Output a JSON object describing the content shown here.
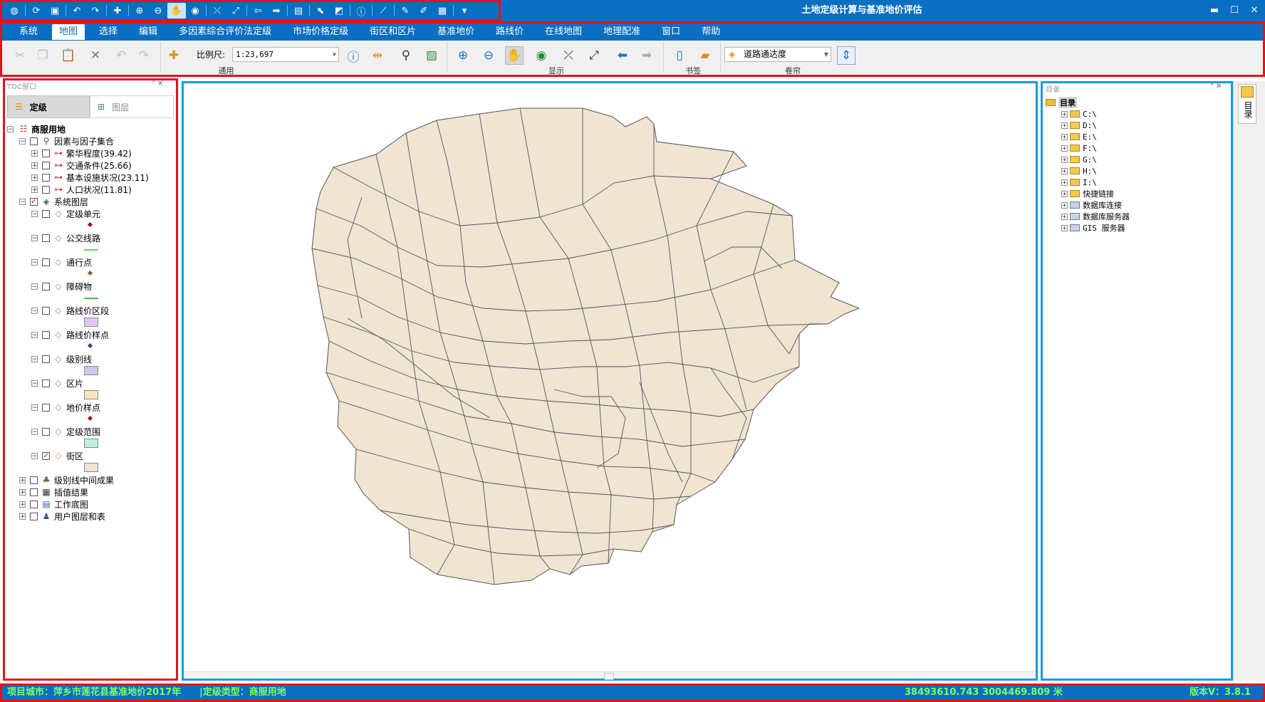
{
  "window": {
    "title": "土地定级计算与基准地价评估",
    "controls": [
      "▬",
      "☐",
      "✕"
    ]
  },
  "quick_access": {
    "icons": [
      "globe-icon",
      "refresh-icon",
      "save-icon",
      "undo-icon",
      "redo-icon",
      "add-data-icon",
      "zoom-in-icon",
      "zoom-out-icon",
      "pan-icon",
      "full-extent-icon",
      "fixed-zoom-in-icon",
      "fixed-zoom-out-icon",
      "back-icon",
      "forward-icon",
      "select-features-icon",
      "select-element-icon",
      "clear-selection-icon",
      "identify-icon",
      "measure-icon",
      "pencil-icon",
      "edit-icon",
      "clipboard-icon",
      "customize-icon"
    ]
  },
  "menu": {
    "items": [
      "系统",
      "地图",
      "选择",
      "编辑",
      "多因素综合评价法定级",
      "市场价格定级",
      "街区和区片",
      "基准地价",
      "路线价",
      "在线地图",
      "地理配准",
      "窗口",
      "帮助"
    ],
    "active_index": 1
  },
  "toolbar": {
    "scale_label": "比例尺:",
    "scale_value": "1:23,697",
    "layer_select_value": "道路通达度",
    "groups": {
      "general": "通用",
      "display": "显示",
      "bookmark": "书签",
      "band": "卷帘"
    }
  },
  "toc": {
    "header": "TOC窗口",
    "header_buttons": "ᴾ ✕",
    "tabs": [
      "定级",
      "图层"
    ],
    "tree": [
      {
        "level": 0,
        "expand": "−",
        "check": null,
        "icon": "land-use-icon",
        "label": "商服用地",
        "bold": true
      },
      {
        "level": 1,
        "expand": "−",
        "check": false,
        "icon": "factor-set-icon",
        "label": "因素与因子集合"
      },
      {
        "level": 2,
        "expand": "+",
        "check": false,
        "icon": "factor-icon",
        "label": "繁华程度(39.42)"
      },
      {
        "level": 2,
        "expand": "+",
        "check": false,
        "icon": "factor-icon",
        "label": "交通条件(25.66)"
      },
      {
        "level": 2,
        "expand": "+",
        "check": false,
        "icon": "factor-icon",
        "label": "基本设施状况(23.11)"
      },
      {
        "level": 2,
        "expand": "+",
        "check": false,
        "icon": "factor-icon",
        "label": "人口状况(11.81)"
      },
      {
        "level": 1,
        "expand": "−",
        "check": true,
        "icon": "layers-icon",
        "label": "系统图层"
      },
      {
        "level": 2,
        "expand": "−",
        "check": false,
        "icon": "layer-diamond-icon",
        "label": "定级单元",
        "symbol": "point",
        "symcolor": "#a31010"
      },
      {
        "level": 2,
        "expand": "−",
        "check": false,
        "icon": "layer-diamond-icon",
        "label": "公交线路",
        "symbol": "line",
        "symcolor": "#5fd66e"
      },
      {
        "level": 2,
        "expand": "−",
        "check": false,
        "icon": "layer-diamond-icon",
        "label": "通行点",
        "symbol": "point",
        "symcolor": "#8a5a2c"
      },
      {
        "level": 2,
        "expand": "−",
        "check": false,
        "icon": "layer-diamond-icon",
        "label": "障碍物",
        "symbol": "line",
        "symcolor": "#3cbf4a"
      },
      {
        "level": 2,
        "expand": "−",
        "check": false,
        "icon": "layer-diamond-icon",
        "label": "路线价区段",
        "symbol": "rect",
        "symcolor": "#e6c3f2"
      },
      {
        "level": 2,
        "expand": "−",
        "check": false,
        "icon": "layer-diamond-icon",
        "label": "路线价样点",
        "symbol": "point",
        "symcolor": "#2a3d8f"
      },
      {
        "level": 2,
        "expand": "−",
        "check": false,
        "icon": "layer-diamond-icon",
        "label": "级别线",
        "symbol": "rect",
        "symcolor": "#cdc9ee"
      },
      {
        "level": 2,
        "expand": "−",
        "check": false,
        "icon": "layer-diamond-icon",
        "label": "区片",
        "symbol": "rect",
        "symcolor": "#f5e6bd"
      },
      {
        "level": 2,
        "expand": "−",
        "check": false,
        "icon": "layer-diamond-icon",
        "label": "地价样点",
        "symbol": "point",
        "symcolor": "#a31010"
      },
      {
        "level": 2,
        "expand": "−",
        "check": false,
        "icon": "layer-diamond-icon",
        "label": "定级范围",
        "symbol": "rect",
        "symcolor": "#bdf0e2"
      },
      {
        "level": 2,
        "expand": "−",
        "check": true,
        "icon": "layer-diamond-icon",
        "label": "街区",
        "symbol": "rect",
        "symcolor": "#f0e4d2"
      },
      {
        "level": 1,
        "expand": "+",
        "check": false,
        "icon": "analysis-icon",
        "label": "级别线中间成果"
      },
      {
        "level": 1,
        "expand": "+",
        "check": false,
        "icon": "grid-icon",
        "label": "插值结果"
      },
      {
        "level": 1,
        "expand": "+",
        "check": false,
        "icon": "basemap-icon",
        "label": "工作底图"
      },
      {
        "level": 1,
        "expand": "+",
        "check": false,
        "icon": "user-icon",
        "label": "用户图层和表"
      }
    ]
  },
  "map": {
    "fill": "#f0e4d2",
    "stroke": "#555555"
  },
  "catalog": {
    "header": "目录",
    "header_buttons": "ᴾ ✕",
    "root": "目录",
    "items": [
      "C:\\",
      "D:\\",
      "E:\\",
      "F:\\",
      "G:\\",
      "H:\\",
      "I:\\",
      "快捷链接",
      "数据库连接",
      "数据库服务器",
      "GIS 服务器"
    ],
    "side_tab": "目录"
  },
  "status": {
    "project": "项目城市：萍乡市莲花县基准地价2017年",
    "grade_type": "|定级类型：商服用地",
    "coords": "38493610.743  3004469.809 米",
    "version": "版本V：3.8.1"
  },
  "colors": {
    "accent": "#0a6fc2",
    "annotation_red": "#e8101a",
    "annotation_blue": "#1a9ae0",
    "status_text": "#7dff5c"
  }
}
